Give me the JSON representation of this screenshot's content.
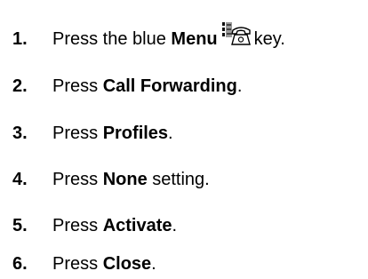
{
  "steps": [
    {
      "number": "1.",
      "prefix": "Press the blue ",
      "bold": "Menu",
      "icon": "menu-phone-key-icon",
      "suffix": " key."
    },
    {
      "number": "2.",
      "prefix": "Press ",
      "bold": "Call Forwarding",
      "suffix": "."
    },
    {
      "number": "3.",
      "prefix": "Press ",
      "bold": "Profiles",
      "suffix": "."
    },
    {
      "number": "4.",
      "prefix": "Press ",
      "bold": "None",
      "suffix": " setting."
    },
    {
      "number": "5.",
      "prefix": "Press ",
      "bold": "Activate",
      "suffix": "."
    },
    {
      "number": "6.",
      "prefix": "Press ",
      "bold": "Close",
      "suffix": "."
    }
  ]
}
